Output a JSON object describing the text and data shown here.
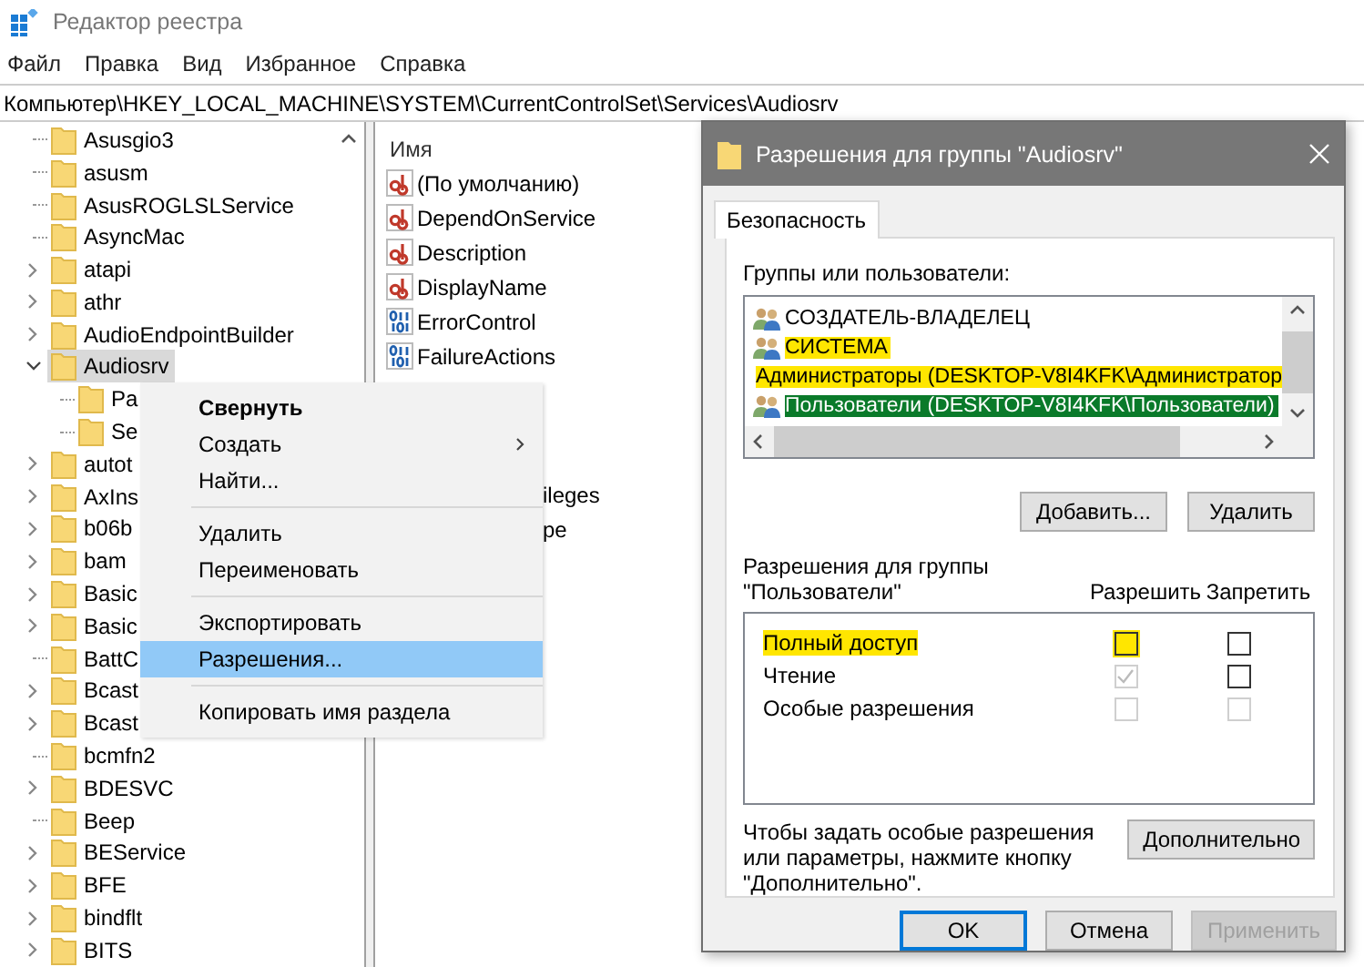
{
  "window": {
    "title": "Редактор реестра"
  },
  "menu": [
    "Файл",
    "Правка",
    "Вид",
    "Избранное",
    "Справка"
  ],
  "address": "Компьютер\\HKEY_LOCAL_MACHINE\\SYSTEM\\CurrentControlSet\\Services\\Audiosrv",
  "tree": [
    {
      "name": "Asusgio3",
      "expandable": false,
      "selected": false
    },
    {
      "name": "asusm",
      "expandable": false,
      "selected": false
    },
    {
      "name": "AsusROGLSLService",
      "expandable": false,
      "selected": false
    },
    {
      "name": "AsyncMac",
      "expandable": false,
      "selected": false
    },
    {
      "name": "atapi",
      "expandable": true,
      "expanded": false,
      "selected": false
    },
    {
      "name": "athr",
      "expandable": true,
      "expanded": false,
      "selected": false
    },
    {
      "name": "AudioEndpointBuilder",
      "expandable": true,
      "expanded": false,
      "selected": false
    },
    {
      "name": "Audiosrv",
      "expandable": true,
      "expanded": true,
      "selected": true,
      "children": [
        {
          "name": "Pa",
          "expandable": false,
          "selected": false
        },
        {
          "name": "Se",
          "expandable": false,
          "selected": false
        }
      ]
    },
    {
      "name": "autot",
      "expandable": true,
      "expanded": false,
      "selected": false
    },
    {
      "name": "AxIns",
      "expandable": true,
      "expanded": false,
      "selected": false
    },
    {
      "name": "b06b",
      "expandable": true,
      "expanded": false,
      "selected": false
    },
    {
      "name": "bam",
      "expandable": true,
      "expanded": false,
      "selected": false
    },
    {
      "name": "Basic",
      "expandable": true,
      "expanded": false,
      "selected": false
    },
    {
      "name": "Basic",
      "expandable": true,
      "expanded": false,
      "selected": false
    },
    {
      "name": "BattC",
      "expandable": false,
      "selected": false
    },
    {
      "name": "Bcast",
      "expandable": true,
      "expanded": false,
      "selected": false
    },
    {
      "name": "Bcast",
      "expandable": true,
      "expanded": false,
      "selected": false
    },
    {
      "name": "bcmfn2",
      "expandable": false,
      "selected": false
    },
    {
      "name": "BDESVC",
      "expandable": true,
      "expanded": false,
      "selected": false
    },
    {
      "name": "Beep",
      "expandable": false,
      "selected": false
    },
    {
      "name": "BEService",
      "expandable": true,
      "expanded": false,
      "selected": false
    },
    {
      "name": "BFE",
      "expandable": true,
      "expanded": false,
      "selected": false
    },
    {
      "name": "bindflt",
      "expandable": true,
      "expanded": false,
      "selected": false
    },
    {
      "name": "BITS",
      "expandable": true,
      "expanded": false,
      "selected": false
    }
  ],
  "values": {
    "column": "Имя",
    "rows": [
      {
        "kind": "string",
        "name": "(По умолчанию)"
      },
      {
        "kind": "string",
        "name": "DependOnService"
      },
      {
        "kind": "string",
        "name": "Description"
      },
      {
        "kind": "string",
        "name": "DisplayName"
      },
      {
        "kind": "binary",
        "name": "ErrorControl"
      },
      {
        "kind": "binary",
        "name": "FailureActions"
      }
    ],
    "covered_row_tails": [
      "ileges",
      "pe"
    ]
  },
  "context_menu": [
    {
      "kind": "item",
      "label": "Свернуть",
      "bold": true,
      "submenu": false,
      "selected": false
    },
    {
      "kind": "item",
      "label": "Создать",
      "bold": false,
      "submenu": true,
      "selected": false
    },
    {
      "kind": "item",
      "label": "Найти...",
      "bold": false,
      "submenu": false,
      "selected": false
    },
    {
      "kind": "separator"
    },
    {
      "kind": "item",
      "label": "Удалить",
      "bold": false,
      "submenu": false,
      "selected": false
    },
    {
      "kind": "item",
      "label": "Переименовать",
      "bold": false,
      "submenu": false,
      "selected": false
    },
    {
      "kind": "separator"
    },
    {
      "kind": "item",
      "label": "Экспортировать",
      "bold": false,
      "submenu": false,
      "selected": false
    },
    {
      "kind": "item",
      "label": "Разрешения...",
      "bold": false,
      "submenu": false,
      "selected": true
    },
    {
      "kind": "separator"
    },
    {
      "kind": "item",
      "label": "Копировать имя раздела",
      "bold": false,
      "submenu": false,
      "selected": false
    }
  ],
  "dialog": {
    "title": "Разрешения для группы \"Audiosrv\"",
    "tabs": [
      {
        "label": "Безопасность",
        "selected": true
      }
    ],
    "groups_label": "Группы или пользователи:",
    "principals": [
      {
        "name": "СОЗДАТЕЛЬ-ВЛАДЕЛЕЦ",
        "highlighted": false,
        "selected": false
      },
      {
        "name": "СИСТЕМА",
        "highlighted": true,
        "selected": false
      },
      {
        "name": "Администраторы (DESKTOP-V8I4KFK\\Администратор",
        "highlighted": true,
        "selected": false
      },
      {
        "name": "Пользователи (DESKTOP-V8I4KFK\\Пользователи)",
        "highlighted": true,
        "selected": true
      }
    ],
    "principal_buttons": [
      "Добавить...",
      "Удалить"
    ],
    "permissions_label": "Разрешения для группы\n\"Пользователи\"",
    "columns": [
      "Разрешить",
      "Запретить"
    ],
    "permissions": [
      {
        "name": "Полный доступ",
        "highlighted": true,
        "allow": {
          "checked": false,
          "disabled": false,
          "highlighted": true
        },
        "deny": {
          "checked": false,
          "disabled": false,
          "highlighted": false
        }
      },
      {
        "name": "Чтение",
        "highlighted": false,
        "allow": {
          "checked": true,
          "disabled": true,
          "highlighted": false
        },
        "deny": {
          "checked": false,
          "disabled": false,
          "highlighted": false
        }
      },
      {
        "name": "Особые разрешения",
        "highlighted": false,
        "allow": {
          "checked": false,
          "disabled": true,
          "highlighted": false
        },
        "deny": {
          "checked": false,
          "disabled": true,
          "highlighted": false
        }
      }
    ],
    "advanced_note": "Чтобы задать особые разрешения или параметры, нажмите кнопку \"Дополнительно\".",
    "advanced_button": "Дополнительно",
    "buttons": [
      {
        "label": "OK",
        "default": true,
        "disabled": false
      },
      {
        "label": "Отмена",
        "default": false,
        "disabled": false
      },
      {
        "label": "Применить",
        "default": false,
        "disabled": true
      }
    ]
  }
}
